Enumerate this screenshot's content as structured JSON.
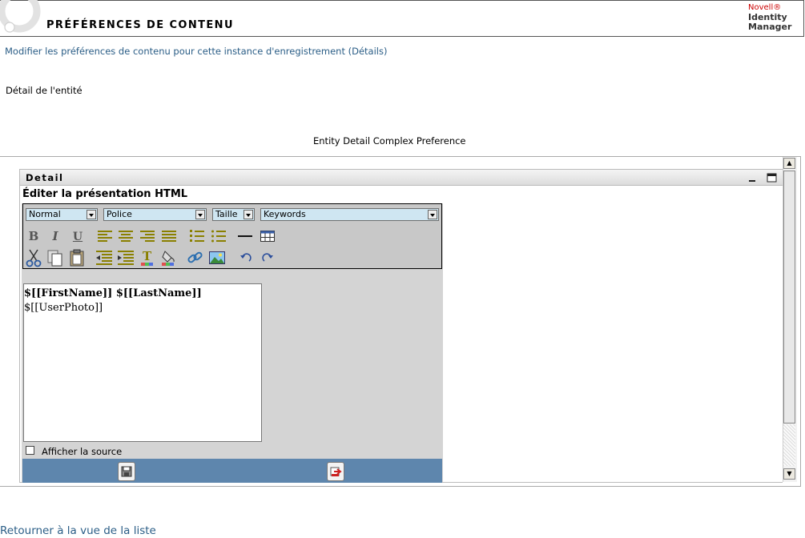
{
  "header": {
    "title": "PRÉFÉRENCES DE CONTENU",
    "brand_vendor": "Novell®",
    "brand_line1": "Identity",
    "brand_line2": "Manager"
  },
  "subtitle": "Modifier les préférences de contenu pour cette instance d'enregistrement (Détails)",
  "entity_label": "Détail de l'entité",
  "complex_label": "Entity Detail Complex Preference",
  "panel": {
    "title": "Detail"
  },
  "editor": {
    "heading": "Éditer la présentation HTML",
    "format_select": "Normal",
    "font_select": "Police",
    "size_select": "Taille",
    "keywords_select": "Keywords",
    "content_line1": "$[[FirstName]] $[[LastName]]",
    "content_line2": "$[[UserPhoto]]",
    "show_source_label": "Afficher la source",
    "bold_glyph": "B",
    "italic_glyph": "I",
    "underline_glyph": "U"
  },
  "back_link": "Retourner à la vue de la liste",
  "icons": [
    "gear-icon",
    "minimize-icon",
    "maximize-icon",
    "bold-icon",
    "italic-icon",
    "underline-icon",
    "align-left-icon",
    "align-center-icon",
    "align-right-icon",
    "justify-icon",
    "ordered-list-icon",
    "unordered-list-icon",
    "horizontal-rule-icon",
    "table-icon",
    "cut-icon",
    "copy-icon",
    "paste-icon",
    "outdent-icon",
    "indent-icon",
    "text-color-icon",
    "highlight-color-icon",
    "link-icon",
    "image-icon",
    "undo-icon",
    "redo-icon",
    "save-icon",
    "cancel-icon"
  ],
  "colors": {
    "link": "#2a5d86",
    "select_bg": "#cfe6f2",
    "save_bar": "#5e86ad",
    "toolbar_bg": "#c8c8c8",
    "brand_red": "#cc0000"
  }
}
